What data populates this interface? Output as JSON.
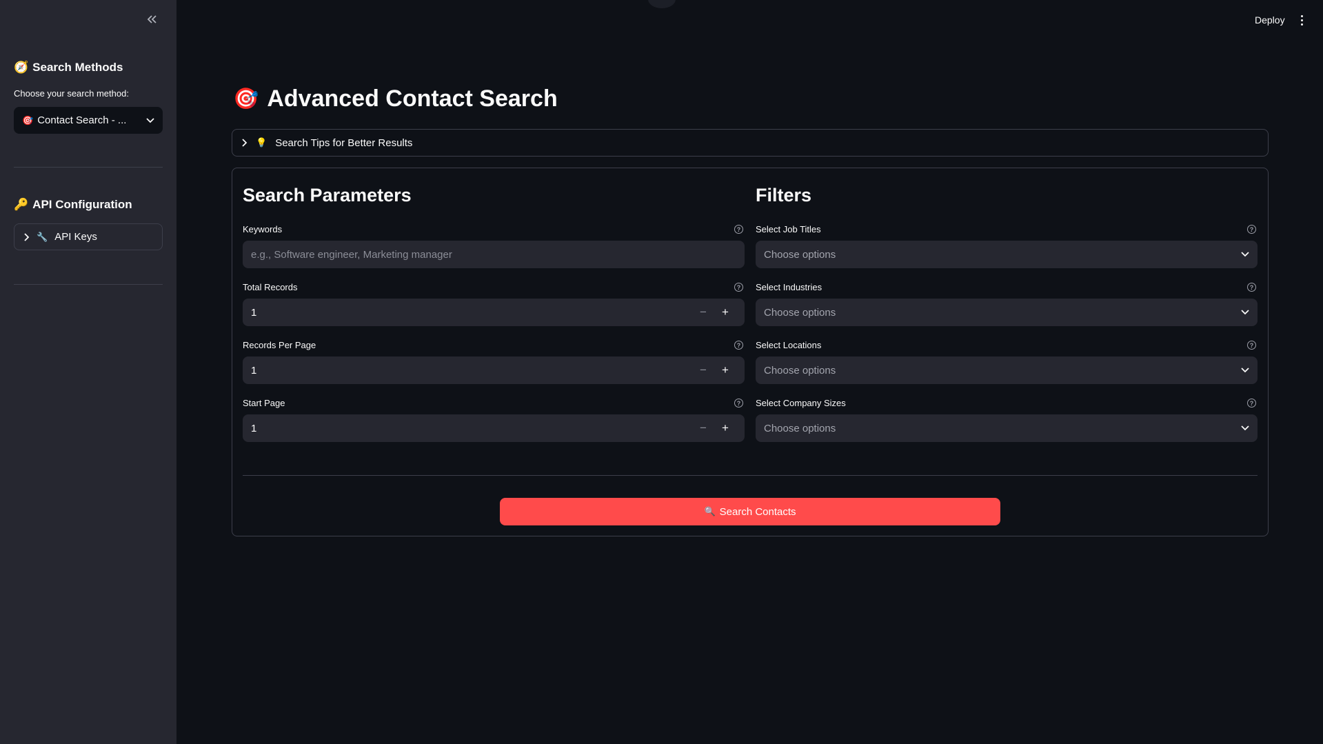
{
  "sidebar": {
    "search_methods": {
      "icon": "🧭",
      "title": "Search Methods"
    },
    "method_label": "Choose your search method:",
    "method_select": {
      "icon": "🎯",
      "value": "Contact Search - ..."
    },
    "api_config": {
      "icon": "🔑",
      "title": "API Configuration"
    },
    "api_keys": {
      "icon": "🔧",
      "label": "API Keys"
    }
  },
  "header": {
    "deploy_label": "Deploy"
  },
  "main": {
    "title_icon": "🎯",
    "title": "Advanced Contact Search",
    "tips": {
      "icon": "💡",
      "label": "Search Tips for Better Results"
    },
    "params": {
      "title": "Search Parameters",
      "keywords": {
        "label": "Keywords",
        "placeholder": "e.g., Software engineer, Marketing manager"
      },
      "total_records": {
        "label": "Total Records",
        "value": "1"
      },
      "records_per_page": {
        "label": "Records Per Page",
        "value": "1"
      },
      "start_page": {
        "label": "Start Page",
        "value": "1"
      }
    },
    "filters": {
      "title": "Filters",
      "job_titles": {
        "label": "Select Job Titles",
        "placeholder": "Choose options"
      },
      "industries": {
        "label": "Select Industries",
        "placeholder": "Choose options"
      },
      "locations": {
        "label": "Select Locations",
        "placeholder": "Choose options"
      },
      "company_sizes": {
        "label": "Select Company Sizes",
        "placeholder": "Choose options"
      }
    },
    "search_button": {
      "icon": "🔍",
      "label": "Search Contacts"
    }
  },
  "colors": {
    "background": "#0e1117",
    "sidebar": "#262730",
    "primary": "#ff4b4b"
  }
}
